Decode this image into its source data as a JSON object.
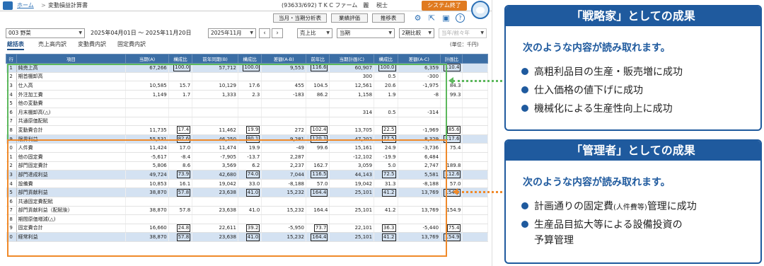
{
  "header": {
    "breadcrumb_home": "ホーム",
    "breadcrumb_sep": ">",
    "breadcrumb_page": "変動損益計算書",
    "company": "(93633/692) T K C ファーム　麗",
    "user": "税士",
    "exit_button": "システム終了"
  },
  "toolbar": {
    "analysis_button": "当月・当期分析表",
    "evaluation_button": "業績評価",
    "trend_button": "推移表"
  },
  "filters": {
    "department": "003 野菜",
    "date_range": "2025年04月01日 ～ 2025年11月20日",
    "month": "2025年11月",
    "sales_ratio": "売上比",
    "period": "当期",
    "comparison": "2期比較",
    "prev_year": "当年/前々年"
  },
  "tabs": [
    "総括表",
    "売上高内訳",
    "変動費内訳",
    "固定費内訳"
  ],
  "unit_note": "(単位：千円)",
  "table": {
    "headers": [
      "行",
      "項目",
      "当期(A)",
      "構成比",
      "前年同期(B)",
      "構成比",
      "差額(A-B)",
      "前年比",
      "当期計画(C)",
      "構成比",
      "差額(A-C)",
      "計画比"
    ],
    "rows": [
      {
        "no": "1",
        "label": "純売上高",
        "v": [
          "67,266",
          "100.0",
          "57,712",
          "100.0",
          "9,553",
          "116.6",
          "60,907",
          "100.0",
          "6,359",
          "110.4"
        ],
        "hl": true
      },
      {
        "no": "2",
        "label": "期首棚卸高",
        "v": [
          "",
          "",
          "",
          "",
          "",
          "",
          "300",
          "0.5",
          "-300",
          ""
        ],
        "hl": false
      },
      {
        "no": "3",
        "label": "仕入高",
        "v": [
          "10,585",
          "15.7",
          "10,129",
          "17.6",
          "455",
          "104.5",
          "12,561",
          "20.6",
          "-1,975",
          "84.3"
        ],
        "hl": false
      },
      {
        "no": "4",
        "label": "外注加工費",
        "v": [
          "1,149",
          "1.7",
          "1,333",
          "2.3",
          "-183",
          "86.2",
          "1,158",
          "1.9",
          "-8",
          "99.3"
        ],
        "hl": false
      },
      {
        "no": "5",
        "label": "他の変動費",
        "v": [
          "",
          "",
          "",
          "",
          "",
          "",
          "",
          "",
          "",
          ""
        ],
        "hl": false
      },
      {
        "no": "6",
        "label": "月末棚卸高(△)",
        "v": [
          "",
          "",
          "",
          "",
          "",
          "",
          "314",
          "0.5",
          "-314",
          ""
        ],
        "hl": false
      },
      {
        "no": "7",
        "label": "共通原価配賦",
        "v": [
          "",
          "",
          "",
          "",
          "",
          "",
          "",
          "",
          "",
          ""
        ],
        "hl": false
      },
      {
        "no": "8",
        "label": "変動費合計",
        "v": [
          "11,735",
          "17.4",
          "11,462",
          "19.9",
          "272",
          "102.4",
          "13,705",
          "22.5",
          "-1,969",
          "85.6"
        ],
        "hl": false
      },
      {
        "no": "9",
        "label": "限界利益",
        "v": [
          "55,531",
          "82.6",
          "46,250",
          "80.1",
          "9,281",
          "120.1",
          "47,202",
          "77.5",
          "8,329",
          "117.6"
        ],
        "hl": true
      },
      {
        "no": "0",
        "label": "人件費",
        "v": [
          "11,424",
          "17.0",
          "11,474",
          "19.9",
          "-49",
          "99.6",
          "15,161",
          "24.9",
          "-3,736",
          "75.4"
        ],
        "hl": false
      },
      {
        "no": "1",
        "label": "他の固定費",
        "v": [
          "-5,617",
          "-8.4",
          "-7,905",
          "-13.7",
          "2,287",
          "",
          "-12,102",
          "-19.9",
          "6,484",
          ""
        ],
        "hl": false
      },
      {
        "no": "2",
        "label": "部門固定費計",
        "v": [
          "5,806",
          "8.6",
          "3,569",
          "6.2",
          "2,237",
          "162.7",
          "3,059",
          "5.0",
          "2,747",
          "189.8"
        ],
        "hl": false
      },
      {
        "no": "3",
        "label": "部門達成利益",
        "v": [
          "49,724",
          "73.9",
          "42,680",
          "74.0",
          "7,044",
          "116.5",
          "44,143",
          "72.5",
          "5,581",
          "112.6"
        ],
        "hl": true
      },
      {
        "no": "4",
        "label": "設備費",
        "v": [
          "10,853",
          "16.1",
          "19,042",
          "33.0",
          "-8,188",
          "57.0",
          "19,042",
          "31.3",
          "-8,188",
          "57.0"
        ],
        "hl": false
      },
      {
        "no": "5",
        "label": "部門貢献利益",
        "v": [
          "38,870",
          "57.8",
          "23,638",
          "41.0",
          "15,232",
          "164.4",
          "25,101",
          "41.2",
          "13,769",
          "154.9"
        ],
        "hl": true
      },
      {
        "no": "6",
        "label": "共通固定費配賦",
        "v": [
          "",
          "",
          "",
          "",
          "",
          "",
          "",
          "",
          "",
          ""
        ],
        "hl": false
      },
      {
        "no": "7",
        "label": "部門貢献利益（配賦後）",
        "v": [
          "38,870",
          "57.8",
          "23,638",
          "41.0",
          "15,232",
          "164.4",
          "25,101",
          "41.2",
          "13,769",
          "154.9"
        ],
        "hl": false
      },
      {
        "no": "8",
        "label": "期間原価増減(△)",
        "v": [
          "",
          "",
          "",
          "",
          "",
          "",
          "",
          "",
          "",
          ""
        ],
        "hl": false
      },
      {
        "no": "9",
        "label": "固定費合計",
        "v": [
          "16,660",
          "24.8",
          "22,611",
          "39.2",
          "-5,950",
          "73.7",
          "22,101",
          "36.3",
          "-5,440",
          "75.4"
        ],
        "hl": false
      },
      {
        "no": "0",
        "label": "経常利益",
        "v": [
          "38,870",
          "57.8",
          "23,638",
          "41.0",
          "15,232",
          "164.4",
          "25,101",
          "41.2",
          "13,769",
          "154.9"
        ],
        "hl": true
      }
    ]
  },
  "panels": {
    "strategist": {
      "title": "「戦略家」としての成果",
      "subtitle": "次のような内容が読み取れます。",
      "items": [
        "高粗利品目の生産・販売増に成功",
        "仕入価格の値下げに成功",
        "機械化による生産性向上に成功"
      ]
    },
    "manager": {
      "title": "「管理者」としての成果",
      "subtitle": "次のような内容が読み取れます。",
      "item1_a": "計画通りの固定費",
      "item1_paren": "(人件費等)",
      "item1_b": "管理に成功",
      "item2_line1": "生産品目拡大等による設備投資の",
      "item2_line2": "予算管理"
    }
  },
  "colors": {
    "header_blue": "#3b6ea5",
    "panel_blue": "#1f5a9e",
    "highlight_row": "#d4e2f2",
    "green_frame": "#5cb85c",
    "orange_frame": "#f08a2a",
    "exit_orange": "#e07a1f"
  },
  "icons": [
    "home-icon",
    "gear-icon",
    "export-icon",
    "print-icon",
    "help-icon",
    "mascot-icon"
  ]
}
